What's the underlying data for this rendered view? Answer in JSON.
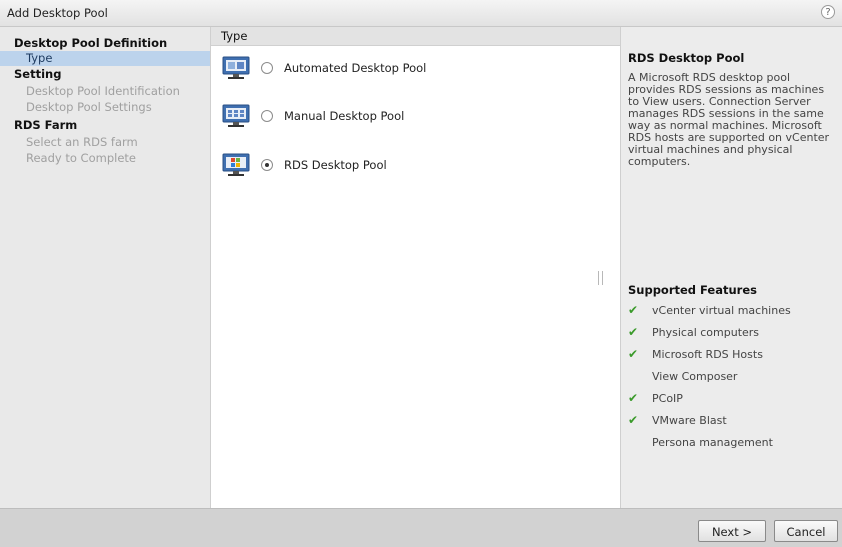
{
  "window": {
    "title": "Add Desktop Pool",
    "help_icon": "?"
  },
  "nav": {
    "items": [
      {
        "label": "Desktop Pool Definition",
        "level": "head"
      },
      {
        "label": "Type",
        "level": "sub",
        "active": true
      },
      {
        "label": "Setting",
        "level": "head"
      },
      {
        "label": "Desktop Pool Identification",
        "level": "sub"
      },
      {
        "label": "Desktop Pool Settings",
        "level": "sub"
      },
      {
        "label": "RDS Farm",
        "level": "head"
      },
      {
        "label": "Select an RDS farm",
        "level": "sub"
      },
      {
        "label": "Ready to Complete",
        "level": "sub"
      }
    ]
  },
  "main": {
    "header": "Type",
    "options": [
      {
        "label": "Automated Desktop Pool",
        "selected": false,
        "icon": "automated-pool-icon"
      },
      {
        "label": "Manual Desktop Pool",
        "selected": false,
        "icon": "manual-pool-icon"
      },
      {
        "label": "RDS Desktop Pool",
        "selected": true,
        "icon": "rds-pool-icon"
      }
    ]
  },
  "description": {
    "title": "RDS Desktop Pool",
    "body": "A Microsoft RDS desktop pool provides RDS sessions as machines to View users. Connection Server manages RDS sessions in the same way as normal machines. Microsoft RDS hosts are supported on vCenter virtual machines and physical computers.",
    "features_title": "Supported Features",
    "features": [
      {
        "label": "vCenter virtual machines",
        "supported": true
      },
      {
        "label": "Physical computers",
        "supported": true
      },
      {
        "label": "Microsoft RDS Hosts",
        "supported": true
      },
      {
        "label": "View Composer",
        "supported": false
      },
      {
        "label": "PCoIP",
        "supported": true
      },
      {
        "label": "VMware Blast",
        "supported": true
      },
      {
        "label": "Persona management",
        "supported": false
      }
    ],
    "check_glyph": "✔"
  },
  "footer": {
    "next_label": "Next >",
    "cancel_label": "Cancel"
  },
  "colors": {
    "accent": "#bcd3ec",
    "check": "#3a9a2a"
  }
}
